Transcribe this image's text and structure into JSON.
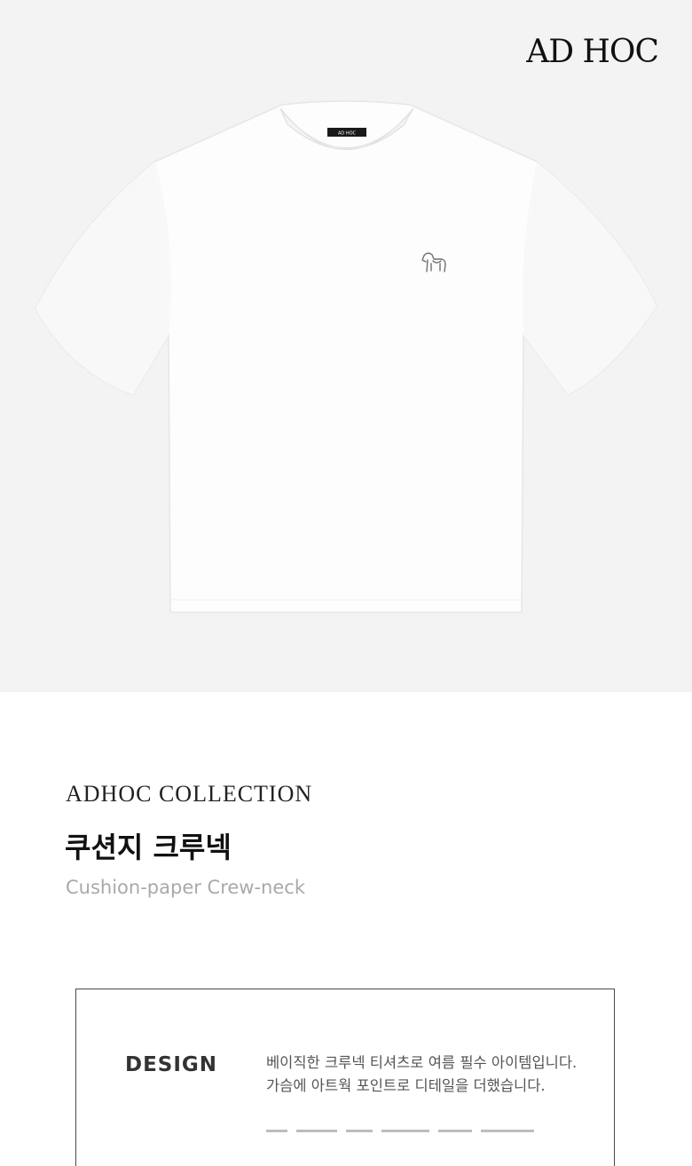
{
  "hero": {
    "brand": "AD HOC",
    "neck_label": "AD HOC",
    "background_color": "#f3f3f3"
  },
  "product": {
    "collection": "ADHOC COLLECTION",
    "name_ko": "쿠션지 크루넥",
    "name_en": "Cushion-paper Crew-neck"
  },
  "design": {
    "label": "DESIGN",
    "lines": [
      "베이직한 크루넥 티셔츠로 여름 필수 아이템입니다.",
      "가슴에 아트웍 포인트로 디테일을 더했습니다."
    ]
  }
}
